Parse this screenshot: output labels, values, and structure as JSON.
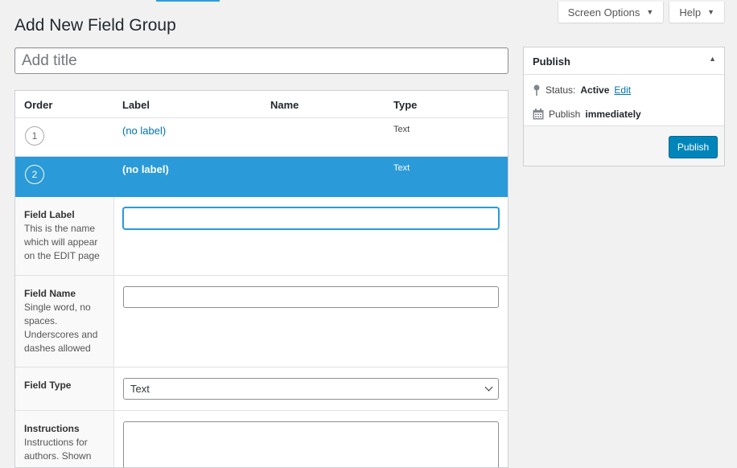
{
  "header": {
    "page_title": "Add New Field Group",
    "screen_options_label": "Screen Options",
    "help_label": "Help"
  },
  "title_field": {
    "placeholder": "Add title",
    "value": ""
  },
  "fields_table": {
    "columns": {
      "order": "Order",
      "label": "Label",
      "name": "Name",
      "type": "Type"
    },
    "rows": [
      {
        "order": "1",
        "label": "(no label)",
        "name": "",
        "type": "Text"
      },
      {
        "order": "2",
        "label": "(no label)",
        "name": "",
        "type": "Text"
      }
    ]
  },
  "field_settings": {
    "field_label": {
      "title": "Field Label",
      "description": "This is the name which will appear on the EDIT page",
      "value": ""
    },
    "field_name": {
      "title": "Field Name",
      "description": "Single word, no spaces. Underscores and dashes allowed",
      "value": ""
    },
    "field_type": {
      "title": "Field Type",
      "selected": "Text"
    },
    "instructions": {
      "title": "Instructions",
      "description": "Instructions for authors. Shown",
      "value": ""
    }
  },
  "publish_box": {
    "title": "Publish",
    "status_label": "Status:",
    "status_value": "Active",
    "edit_link": "Edit",
    "publish_label": "Publish",
    "publish_when": "immediately",
    "button_label": "Publish"
  },
  "colors": {
    "accent": "#2a9ad8",
    "primary_button": "#0085ba",
    "link": "#0073aa"
  }
}
